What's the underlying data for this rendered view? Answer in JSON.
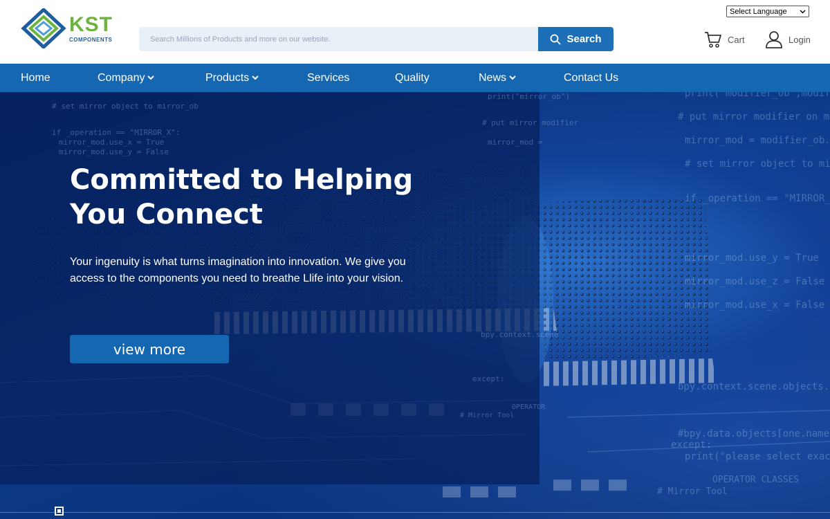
{
  "brand": {
    "logo_main": "KST",
    "logo_sub": "COMPONENTS"
  },
  "colors": {
    "primary_blue": "#1567b1",
    "logo_green": "#6cb33f",
    "search_bg": "#e8f0f8"
  },
  "search": {
    "placeholder": "Search Millions of Products and more on our website.",
    "button_label": "Search",
    "icon": "search-icon"
  },
  "language": {
    "selected": "Select Language"
  },
  "header": {
    "cart_label": "Cart",
    "login_label": "Login"
  },
  "nav": {
    "items": [
      {
        "label": "Home"
      },
      {
        "label": "Company"
      },
      {
        "label": "Products"
      },
      {
        "label": "Services"
      },
      {
        "label": "Quality"
      },
      {
        "label": "News"
      },
      {
        "label": "Contact Us"
      }
    ]
  },
  "hero": {
    "title_line1": "Committed to Helping",
    "title_line2": "You Connect",
    "text": "Your ingenuity is what turns imagination into innovation. We give you access to the components you need to breathe Llife into your vision.",
    "button_label": "view more"
  }
}
